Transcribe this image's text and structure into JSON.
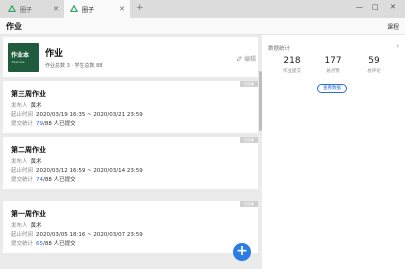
{
  "browser": {
    "tabs": [
      {
        "label": "圈子",
        "active": false
      },
      {
        "label": "圈子",
        "active": true
      }
    ],
    "new_tab": "+",
    "window_controls": {
      "minimize": "—",
      "maximize": "□",
      "close": "✕"
    }
  },
  "header": {
    "title": "作业",
    "link": "课程"
  },
  "class_card": {
    "cover_title": "作业本",
    "cover_subtitle": "Exercise",
    "name": "作业",
    "stats": "作业总数 3 · 学生总数 88",
    "edit_label": "编辑"
  },
  "homework": [
    {
      "badge": "已结束",
      "title": "第三周作业",
      "publisher_label": "发布人",
      "publisher": "黄术",
      "time_label": "起止时间",
      "time": "2020/03/19 16:35 ~ 2020/03/21 23:59",
      "submit_label": "提交统计",
      "submitted": "79",
      "total": "/88 人已提交"
    },
    {
      "badge": "已结束",
      "title": "第二周作业",
      "publisher_label": "发布人",
      "publisher": "黄术",
      "time_label": "起止时间",
      "time": "2020/03/12 16:59 ~ 2020/03/14 23:59",
      "submit_label": "提交统计",
      "submitted": "74",
      "total": "/88 人已提交"
    },
    {
      "badge": "已结束",
      "title": "第一周作业",
      "publisher_label": "发布人",
      "publisher": "黄术",
      "time_label": "起止时间",
      "time": "2020/03/05 18:16 ~ 2020/03/07 23:59",
      "submit_label": "提交统计",
      "submitted": "65",
      "total": "/88 人已提交"
    }
  ],
  "fab": "+",
  "stats_panel": {
    "title": "数据统计",
    "arrow": "›",
    "items": [
      {
        "value": "218",
        "label": "作业提交"
      },
      {
        "value": "177",
        "label": "总点赞"
      },
      {
        "value": "59",
        "label": "总评论"
      }
    ],
    "detail_button": "查看数据"
  },
  "colors": {
    "accent": "#2d6cdf",
    "fab": "#2d7be5",
    "cover": "#1f5c3d"
  }
}
